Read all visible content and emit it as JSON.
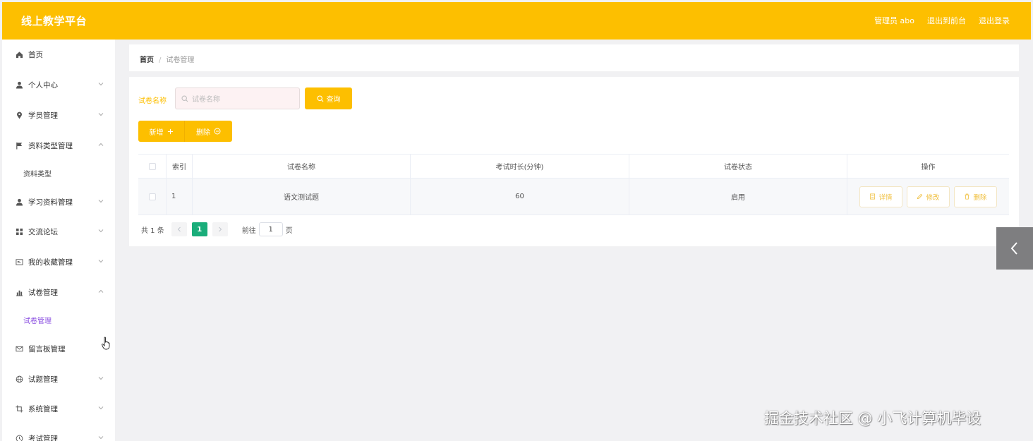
{
  "header": {
    "brand": "线上教学平台",
    "links": [
      "管理员 abo",
      "退出到前台",
      "退出登录"
    ]
  },
  "sidebar": {
    "items": [
      {
        "label": "首页",
        "icon": "home-icon"
      },
      {
        "label": "个人中心",
        "icon": "user-icon"
      },
      {
        "label": "学员管理",
        "icon": "pin-icon"
      },
      {
        "label": "资料类型管理",
        "icon": "flag-icon"
      },
      {
        "label": "学习资料管理",
        "icon": "user-icon"
      },
      {
        "label": "交流论坛",
        "icon": "grid-icon"
      },
      {
        "label": "我的收藏管理",
        "icon": "card-icon"
      },
      {
        "label": "试卷管理",
        "icon": "chart-icon"
      },
      {
        "label": "留言板管理",
        "icon": "mail-icon"
      },
      {
        "label": "试题管理",
        "icon": "globe-icon"
      },
      {
        "label": "系统管理",
        "icon": "crop-icon"
      },
      {
        "label": "考试管理",
        "icon": "clock-icon"
      }
    ],
    "sub_items": {
      "material_type": "资料类型",
      "exam_paper": "试卷管理"
    }
  },
  "breadcrumb": {
    "home": "首页",
    "separator": "/",
    "current": "试卷管理"
  },
  "search": {
    "label": "试卷名称",
    "placeholder": "试卷名称",
    "button": "查询"
  },
  "actions": {
    "add": "新增",
    "delete": "删除"
  },
  "table": {
    "columns": [
      "索引",
      "试卷名称",
      "考试时长(分钟)",
      "试卷状态",
      "操作"
    ],
    "rows": [
      {
        "index": "1",
        "name": "语文测试题",
        "duration": "60",
        "status": "启用"
      }
    ],
    "ops": {
      "detail": "详情",
      "edit": "修改",
      "delete": "删除"
    }
  },
  "pagination": {
    "total": "共 1 条",
    "current_page": "1",
    "goto_label": "前往",
    "goto_value": "1",
    "page_unit": "页"
  },
  "watermark": "掘金技术社区 @ 小飞计算机毕设",
  "colors": {
    "accent": "#fdbf00",
    "page_active": "#1aad7a",
    "sub_active": "#8a4ee0",
    "side_tab": "#7e7e80"
  }
}
